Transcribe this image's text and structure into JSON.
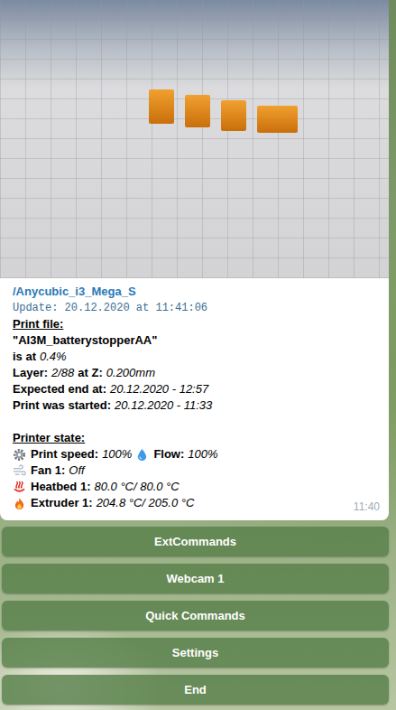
{
  "message": {
    "title": "/Anycubic_i3_Mega_S",
    "update": "Update: 20.12.2020 at 11:41:06",
    "sections": [
      {
        "heading": "Print file:",
        "lines": [
          [
            {
              "kind": "label",
              "text": "\"AI3M_batterystopperAA\""
            }
          ],
          [
            {
              "kind": "label",
              "text": "is at"
            },
            {
              "kind": "value",
              "text": "0.4%"
            }
          ],
          [
            {
              "kind": "label",
              "text": "Layer:"
            },
            {
              "kind": "value",
              "text": "2/88"
            },
            {
              "kind": "label",
              "text": "at Z:"
            },
            {
              "kind": "value",
              "text": "0.200mm"
            }
          ],
          [
            {
              "kind": "label",
              "text": "Expected end at:"
            },
            {
              "kind": "value",
              "text": "20.12.2020 - 12:57"
            }
          ],
          [
            {
              "kind": "label",
              "text": "Print was started:"
            },
            {
              "kind": "value",
              "text": "20.12.2020 - 11:33"
            }
          ]
        ]
      },
      {
        "heading": "Printer state:",
        "lines": [
          [
            {
              "kind": "icon"
            },
            {
              "kind": "label",
              "text": "Print speed:"
            },
            {
              "kind": "value",
              "text": "100%"
            },
            {
              "kind": "icon"
            },
            {
              "kind": "label",
              "text": "Flow:"
            },
            {
              "kind": "value",
              "text": "100%"
            }
          ],
          [
            {
              "kind": "icon"
            },
            {
              "kind": "label",
              "text": "Fan 1:"
            },
            {
              "kind": "value",
              "text": "Off"
            }
          ],
          [
            {
              "kind": "icon"
            },
            {
              "kind": "label",
              "text": "Heatbed 1:"
            },
            {
              "kind": "value",
              "text": "80.0 °C/ 80.0 °C"
            }
          ],
          [
            {
              "kind": "icon"
            },
            {
              "kind": "label",
              "text": "Extruder 1:"
            },
            {
              "kind": "value",
              "text": "204.8 °C/ 205.0 °C"
            }
          ]
        ]
      }
    ],
    "time": "11:40"
  },
  "keyboard": [
    "ExtCommands",
    "Webcam 1",
    "Quick Commands",
    "Settings",
    "End"
  ]
}
